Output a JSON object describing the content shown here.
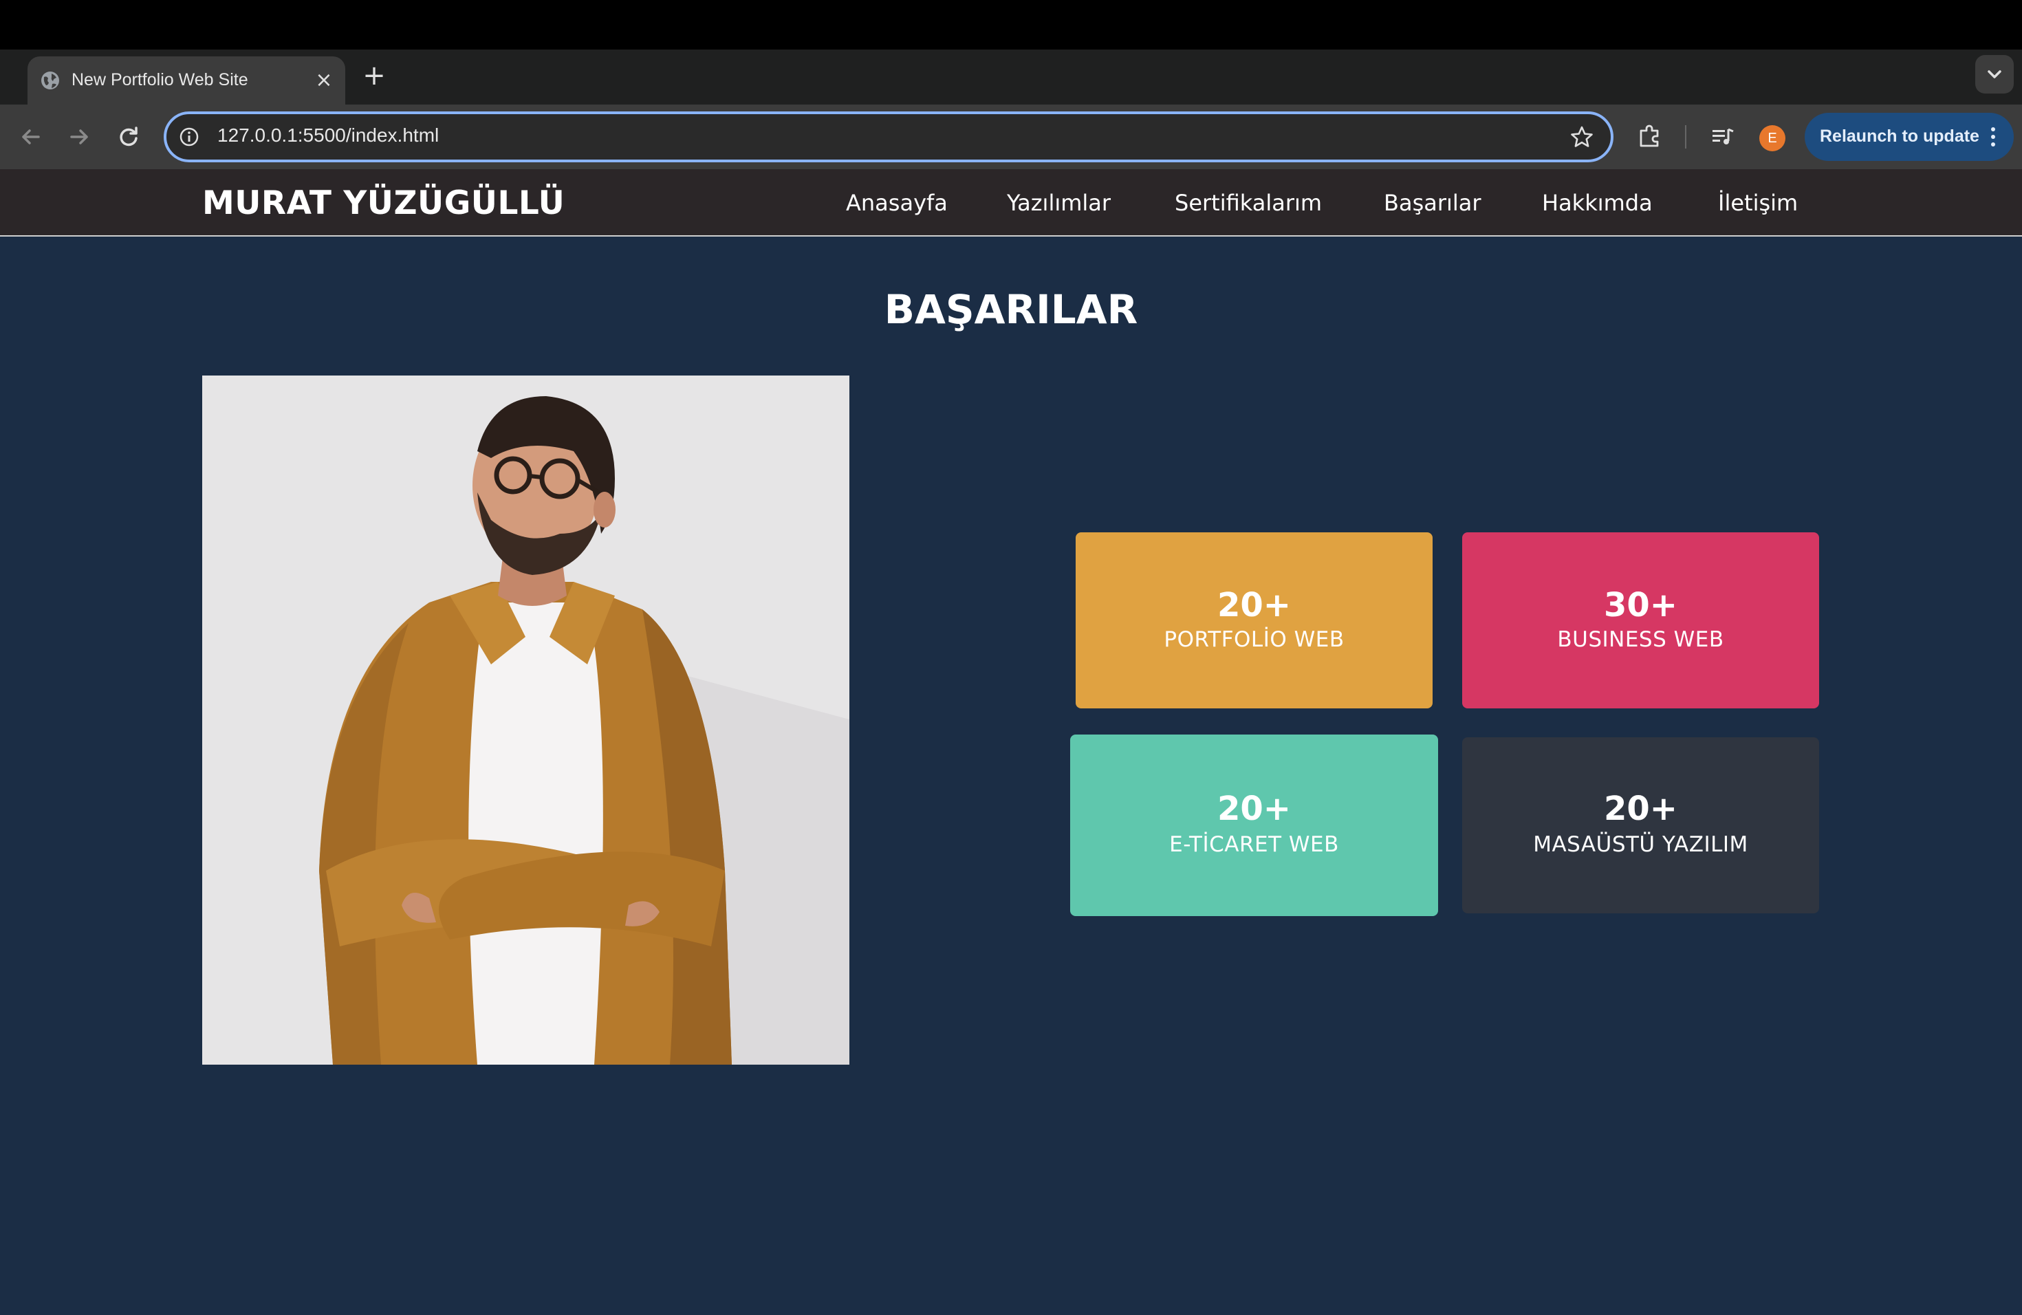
{
  "browser": {
    "tab_title": "New Portfolio Web Site",
    "tab_close": "×",
    "new_tab": "+",
    "url": "127.0.0.1:5500/index.html",
    "profile_initial": "E",
    "relaunch_label": "Relaunch to update"
  },
  "site": {
    "brand": "MURAT YÜZÜGÜLLÜ",
    "nav": [
      "Anasayfa",
      "Yazılımlar",
      "Sertifikalarım",
      "Başarılar",
      "Hakkımda",
      "İletişim"
    ],
    "section_title": "BAŞARILAR",
    "stats": [
      {
        "value": "20+",
        "label": "PORTFOLİO WEB",
        "color": "#e0a241"
      },
      {
        "value": "30+",
        "label": "BUSINESS WEB",
        "color": "#d63763"
      },
      {
        "value": "20+",
        "label": "E-TİCARET WEB",
        "color": "#5fc7ad"
      },
      {
        "value": "20+",
        "label": "MASAÜSTÜ YAZILIM",
        "color": "#2f3540"
      }
    ]
  },
  "icons": {
    "tab_favicon": "globe-icon",
    "back": "arrow-left-icon",
    "forward": "arrow-right-icon",
    "reload": "reload-icon",
    "site_info": "info-icon",
    "bookmark": "star-icon",
    "extensions": "puzzle-icon",
    "media": "media-queue-icon",
    "menu": "kebab-menu-icon",
    "tab_search": "chevron-down-icon"
  }
}
